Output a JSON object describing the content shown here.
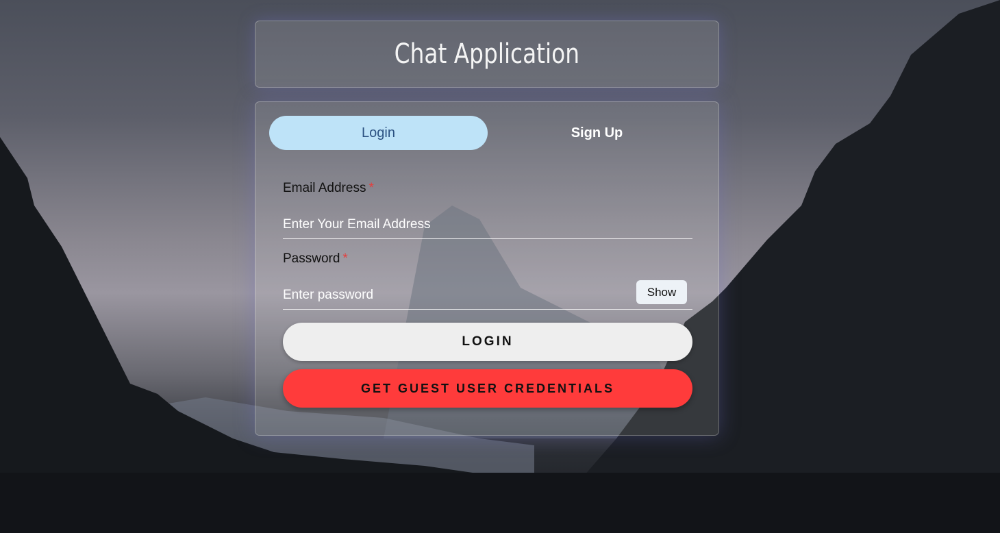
{
  "header": {
    "title": "Chat Application"
  },
  "tabs": [
    {
      "label": "Login",
      "active": true
    },
    {
      "label": "Sign Up",
      "active": false
    }
  ],
  "form": {
    "email": {
      "label": "Email Address",
      "required_mark": "*",
      "placeholder": "Enter Your Email Address",
      "value": ""
    },
    "password": {
      "label": "Password",
      "required_mark": "*",
      "placeholder": "Enter password",
      "value": "",
      "toggle_label": "Show"
    },
    "login_button": "LOGIN",
    "guest_button": "GET GUEST USER CREDENTIALS"
  },
  "colors": {
    "active_tab_bg": "#bee3f8",
    "active_tab_text": "#2c5282",
    "guest_button_bg": "#ff3b3b",
    "login_button_bg": "#eeeeee",
    "required_mark": "#e53e3e"
  }
}
